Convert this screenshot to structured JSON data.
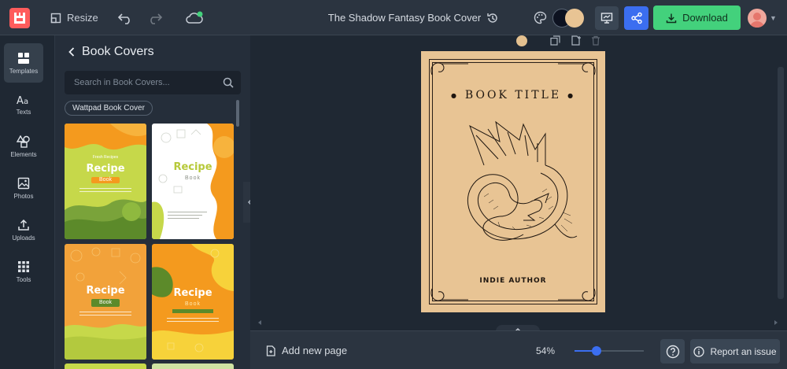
{
  "header": {
    "resize_label": "Resize",
    "document_title": "The Shadow Fantasy Book Cover",
    "download_label": "Download",
    "primary_color": "#0d1220",
    "secondary_color": "#e8c494"
  },
  "rail": {
    "items": [
      {
        "label": "Templates",
        "icon": "templates-icon",
        "active": true
      },
      {
        "label": "Texts",
        "icon": "text-icon"
      },
      {
        "label": "Elements",
        "icon": "elements-icon"
      },
      {
        "label": "Photos",
        "icon": "photo-icon"
      },
      {
        "label": "Uploads",
        "icon": "upload-icon"
      },
      {
        "label": "Tools",
        "icon": "tools-icon"
      }
    ]
  },
  "panel": {
    "title": "Book Covers",
    "search_placeholder": "Search in Book Covers...",
    "chip": "Wattpad Book Cover",
    "templates": [
      {
        "title": "Recipe",
        "subtitle": "Book",
        "theme": "green-orange"
      },
      {
        "title": "Recipe",
        "subtitle": "Book",
        "theme": "white-orange"
      },
      {
        "title": "Recipe",
        "subtitle": "Book",
        "theme": "orange-green"
      },
      {
        "title": "Recipe",
        "subtitle": "Book",
        "theme": "orange-yellow"
      }
    ]
  },
  "canvas": {
    "book_title": "BOOK TITLE",
    "author": "INDIE AUTHOR",
    "cover_color": "#e8c494"
  },
  "footer": {
    "add_page_label": "Add new page",
    "zoom": "54%",
    "zoom_fraction": 0.54,
    "report_label": "Report an issue"
  },
  "colors": {
    "accent_blue": "#3b6ef0",
    "download_green": "#43d17c",
    "logo_red": "#ff5c5c"
  }
}
